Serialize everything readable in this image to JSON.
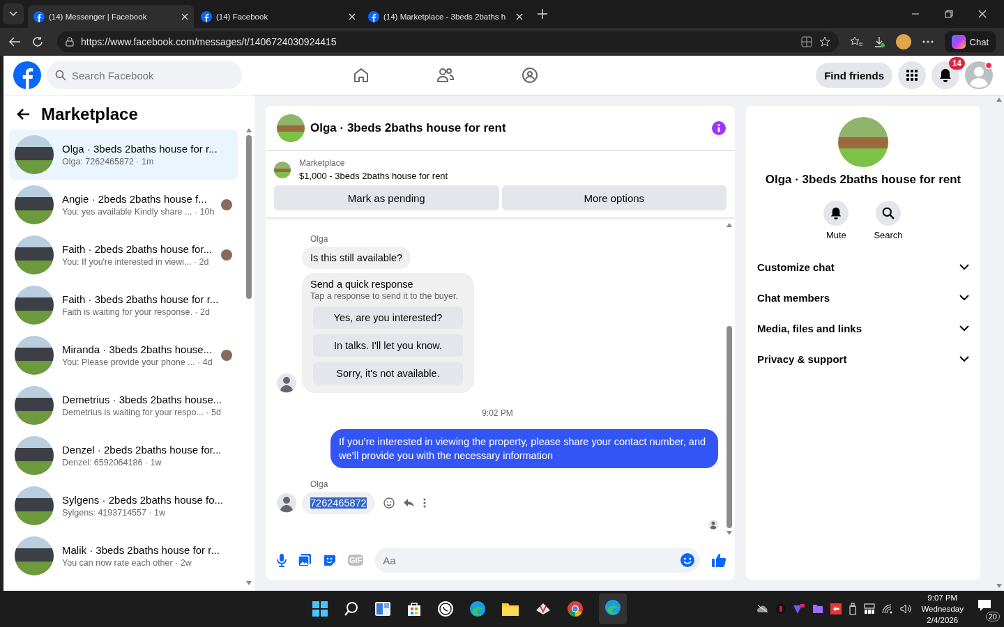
{
  "browser": {
    "tabs": [
      {
        "title": "(14) Messenger | Facebook",
        "selected": true
      },
      {
        "title": "(14) Facebook",
        "selected": false
      },
      {
        "title": "(14) Marketplace - 3beds 2baths h",
        "selected": false
      }
    ],
    "url": "https://www.facebook.com/messages/t/1406724030924415",
    "chat_button": "Chat"
  },
  "header": {
    "search": {
      "placeholder": "Search Facebook"
    },
    "find_friends": "Find friends",
    "notification_count": "14"
  },
  "sidebar": {
    "title": "Marketplace",
    "items": [
      {
        "title": "Olga · 3beds 2baths house for r...",
        "preview": "Olga: 7262465872 · 1m",
        "selected": true,
        "seen_avatar": false
      },
      {
        "title": "Angie · 2beds 2baths house f...",
        "preview": "You: yes available Kindly share ...  · 10h",
        "selected": false,
        "seen_avatar": true
      },
      {
        "title": "Faith · 2beds 2baths house for...",
        "preview": "You: If you're interested in viewi...  · 2d",
        "selected": false,
        "seen_avatar": true
      },
      {
        "title": "Faith · 3beds 2baths house for r...",
        "preview": "Faith is waiting for your response. · 2d",
        "selected": false,
        "seen_avatar": false
      },
      {
        "title": "Miranda · 3beds 2baths house...",
        "preview": "You: Please provide your phone ...  · 4d",
        "selected": false,
        "seen_avatar": true
      },
      {
        "title": "Demetrius · 3beds 2baths house...",
        "preview": "Demetrius is waiting for your respo... · 5d",
        "selected": false,
        "seen_avatar": false
      },
      {
        "title": "Denzel · 2beds 2baths house for...",
        "preview": "Denzel: 6592064186 · 1w",
        "selected": false,
        "seen_avatar": false
      },
      {
        "title": "Sylgens · 2beds 2baths house fo...",
        "preview": "Sylgens: 4193714557 · 1w",
        "selected": false,
        "seen_avatar": false
      },
      {
        "title": "Malik · 3beds 2baths house for r...",
        "preview": "You can now rate each other · 2w",
        "selected": false,
        "seen_avatar": false
      }
    ]
  },
  "chat": {
    "title": "Olga · 3beds 2baths house for rent",
    "listing_label": "Marketplace",
    "listing": "$1,000 - 3beds 2baths house for rent",
    "actions": [
      "Mark as pending",
      "More options"
    ],
    "messages": [
      {
        "kind": "sender",
        "text": "Olga"
      },
      {
        "kind": "incoming",
        "text": "Is this still available?",
        "avatar": false,
        "highlighted": false
      },
      {
        "kind": "quick",
        "title": "Send a quick response",
        "subtitle": "Tap a response to send it to the buyer.",
        "options": [
          "Yes, are you interested?",
          "In talks. I'll let you know.",
          "Sorry, it's not available."
        ],
        "avatar": true
      },
      {
        "kind": "time",
        "text": "9:02 PM"
      },
      {
        "kind": "outgoing",
        "text": "If you’re interested in viewing the property, please share your contact number, and we’ll provide you with the necessary information"
      },
      {
        "kind": "sender",
        "text": "Olga"
      },
      {
        "kind": "incoming",
        "text": "7262465872",
        "avatar": true,
        "highlighted": true
      }
    ],
    "composer": {
      "placeholder": "Aa",
      "gif": "GIF"
    }
  },
  "details": {
    "title": "Olga · 3beds 2baths house for rent",
    "actions": [
      "Mute",
      "Search"
    ],
    "sections": [
      {
        "label": "Customize chat",
        "expanded": false
      },
      {
        "label": "Chat members",
        "expanded": false
      },
      {
        "label": "Media, files and links",
        "expanded": false
      },
      {
        "label": "Privacy & support",
        "expanded": false
      }
    ]
  },
  "taskbar": {
    "time": "9:07 PM",
    "day": "Wednesday",
    "date": "2/4/2026",
    "notifications": "20"
  }
}
